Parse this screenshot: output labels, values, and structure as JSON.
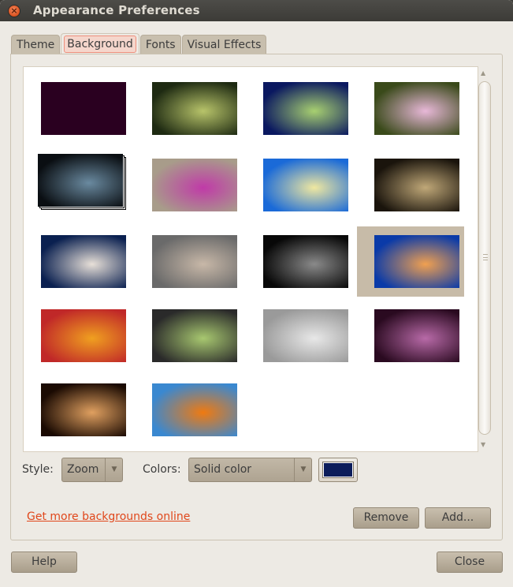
{
  "window": {
    "title": "Appearance Preferences",
    "close_icon": "close-icon"
  },
  "tabs": [
    {
      "label": "Theme",
      "active": false
    },
    {
      "label": "Background",
      "active": true
    },
    {
      "label": "Fonts",
      "active": false
    },
    {
      "label": "Visual Effects",
      "active": false
    }
  ],
  "backgrounds": {
    "selected_index": 11,
    "items": [
      {
        "name": "solid-dark-purple",
        "colors": [
          "#2a0020",
          "#2a0020"
        ]
      },
      {
        "name": "tree-canopy",
        "colors": [
          "#1e2a12",
          "#b8c46a"
        ]
      },
      {
        "name": "blue-light-burst",
        "colors": [
          "#0a1860",
          "#a8d070"
        ]
      },
      {
        "name": "pink-daisy",
        "colors": [
          "#3a4a1a",
          "#e8b8d8"
        ]
      },
      {
        "name": "spiral-galaxy-stack",
        "colors": [
          "#0a0e12",
          "#6a8aa0"
        ]
      },
      {
        "name": "magenta-flower",
        "colors": [
          "#a89c8a",
          "#c03aa8"
        ]
      },
      {
        "name": "white-daisy-blue-sky",
        "colors": [
          "#1a6ad8",
          "#f0e8a0"
        ]
      },
      {
        "name": "dewy-leaf",
        "colors": [
          "#1a140c",
          "#c0a878"
        ]
      },
      {
        "name": "dandelion",
        "colors": [
          "#0a2050",
          "#e8e0d8"
        ]
      },
      {
        "name": "pebbles",
        "colors": [
          "#6a6a6a",
          "#c8b8a8"
        ]
      },
      {
        "name": "white-flower-dark",
        "colors": [
          "#080808",
          "#8a8a8a"
        ]
      },
      {
        "name": "pier-sunset",
        "colors": [
          "#0a3aa8",
          "#f0a050"
        ]
      },
      {
        "name": "bokeh-red",
        "colors": [
          "#c02828",
          "#f0a020"
        ]
      },
      {
        "name": "green-field-blur",
        "colors": [
          "#2a2a2a",
          "#a8c870"
        ]
      },
      {
        "name": "water-glass",
        "colors": [
          "#9a9a9a",
          "#e8e8e8"
        ]
      },
      {
        "name": "purple-bokeh",
        "colors": [
          "#2a0a20",
          "#b86aa8"
        ]
      },
      {
        "name": "warm-bokeh-lights",
        "colors": [
          "#1a0a02",
          "#e0a060"
        ]
      },
      {
        "name": "orange-flower",
        "colors": [
          "#3a88d0",
          "#f07a10"
        ]
      }
    ]
  },
  "controls": {
    "style_label": "Style:",
    "style_value": "Zoom",
    "colors_label": "Colors:",
    "colors_value": "Solid color",
    "color_swatch": "#0b1c5a"
  },
  "links": {
    "more_backgrounds": "Get more backgrounds online"
  },
  "buttons": {
    "remove": "Remove",
    "add": "Add...",
    "help": "Help",
    "close": "Close"
  }
}
